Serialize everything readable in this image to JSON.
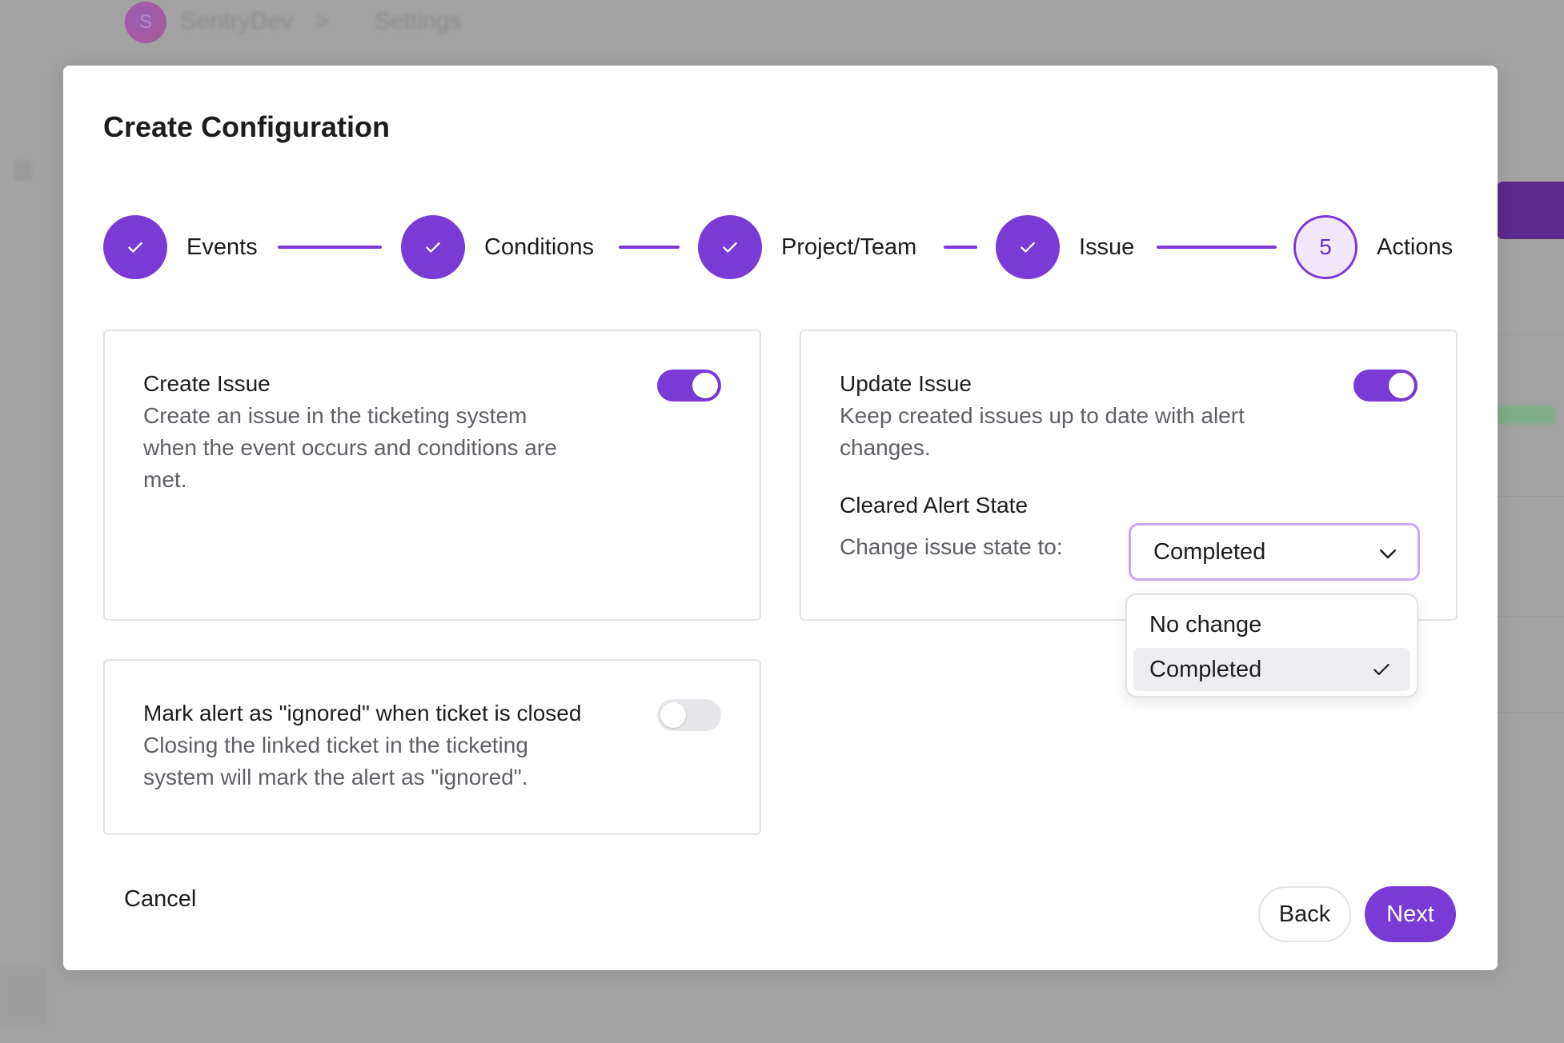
{
  "background": {
    "breadcrumb_org": "SentryDev",
    "breadcrumb_separator": ">",
    "breadcrumb_page": "Settings",
    "avatar_letter": "S"
  },
  "modal": {
    "title": "Create Configuration",
    "steps": [
      {
        "label": "Events",
        "status": "complete",
        "icon": "check-icon"
      },
      {
        "label": "Conditions",
        "status": "complete",
        "icon": "check-icon"
      },
      {
        "label": "Project/Team",
        "status": "complete",
        "icon": "check-icon"
      },
      {
        "label": "Issue",
        "status": "complete",
        "icon": "check-icon"
      },
      {
        "label": "Actions",
        "status": "current",
        "number": "5"
      }
    ],
    "create_issue": {
      "title": "Create Issue",
      "description": "Create an issue in the ticketing system when the event occurs and conditions are met.",
      "enabled": true
    },
    "update_issue": {
      "title": "Update Issue",
      "description": "Keep created issues up to date with alert changes.",
      "enabled": true,
      "cleared_alert_state_label": "Cleared Alert State",
      "change_state_label": "Change issue state to:",
      "selected_value": "Completed",
      "options": [
        "No change",
        "Completed"
      ]
    },
    "mark_ignored": {
      "title": "Mark alert as \"ignored\" when ticket is closed",
      "description": "Closing the linked ticket in the ticketing system will mark the alert as \"ignored\".",
      "enabled": false
    },
    "buttons": {
      "cancel": "Cancel",
      "back": "Back",
      "next": "Next"
    }
  },
  "colors": {
    "accent": "#7a3ad6",
    "accent_light": "#f1e8fc",
    "overlay": "#a3a3a3",
    "text": "#1d1d1f",
    "muted_text": "#5f5f66"
  }
}
